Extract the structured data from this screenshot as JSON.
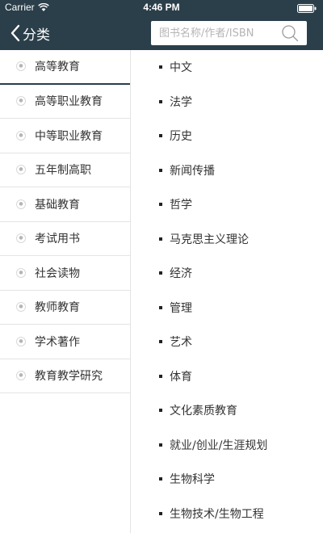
{
  "status_bar": {
    "carrier": "Carrier",
    "time": "4:46 PM"
  },
  "nav": {
    "back_label": "分类",
    "search_placeholder": "图书名称/作者/ISBN"
  },
  "categories": [
    {
      "label": "高等教育",
      "icon": "category-icon",
      "selected": true
    },
    {
      "label": "高等职业教育",
      "icon": "category-icon",
      "selected": false
    },
    {
      "label": "中等职业教育",
      "icon": "category-icon",
      "selected": false
    },
    {
      "label": "五年制高职",
      "icon": "category-icon",
      "selected": false
    },
    {
      "label": "基础教育",
      "icon": "category-icon",
      "selected": false
    },
    {
      "label": "考试用书",
      "icon": "category-icon",
      "selected": false
    },
    {
      "label": "社会读物",
      "icon": "category-icon",
      "selected": false
    },
    {
      "label": "教师教育",
      "icon": "category-icon",
      "selected": false
    },
    {
      "label": "学术著作",
      "icon": "category-icon",
      "selected": false
    },
    {
      "label": "教育教学研究",
      "icon": "category-icon",
      "selected": false
    }
  ],
  "subcategories": [
    {
      "label": "中文"
    },
    {
      "label": "法学"
    },
    {
      "label": "历史"
    },
    {
      "label": "新闻传播"
    },
    {
      "label": "哲学"
    },
    {
      "label": "马克思主义理论"
    },
    {
      "label": "经济"
    },
    {
      "label": "管理"
    },
    {
      "label": "艺术"
    },
    {
      "label": "体育"
    },
    {
      "label": "文化素质教育"
    },
    {
      "label": "就业/创业/生涯规划"
    },
    {
      "label": "生物科学"
    },
    {
      "label": "生物技术/生物工程"
    }
  ],
  "colors": {
    "header_bg": "#2b3f4a",
    "selected_underline": "#2b3f4a",
    "text": "#333333",
    "divider": "#e4e4e4"
  }
}
